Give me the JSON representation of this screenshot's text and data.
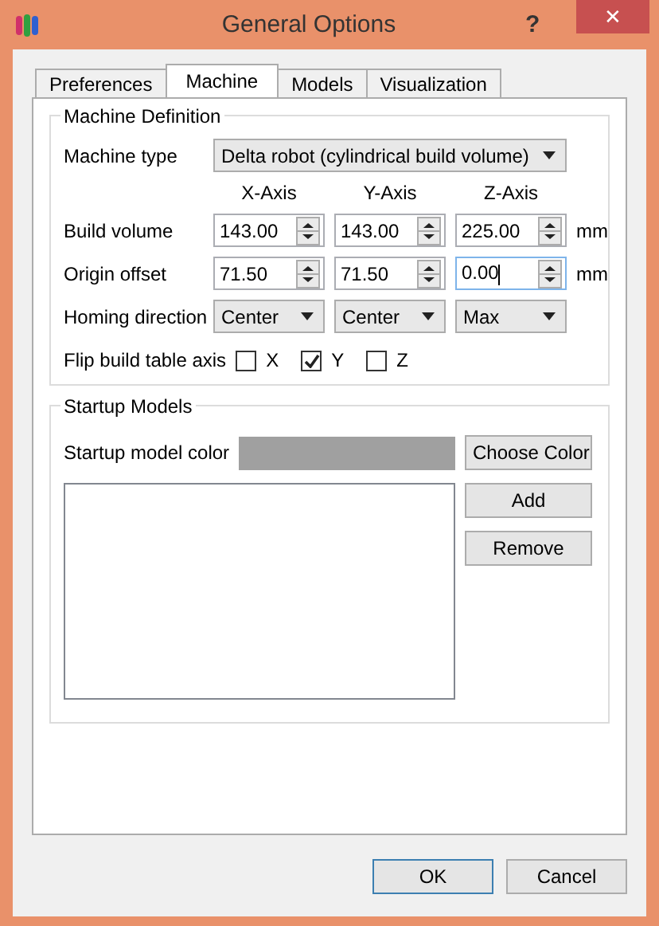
{
  "window": {
    "title": "General Options",
    "help": "?",
    "close": "✕"
  },
  "tabs": [
    {
      "label": "Preferences",
      "selected": false
    },
    {
      "label": "Machine",
      "selected": true
    },
    {
      "label": "Models",
      "selected": false
    },
    {
      "label": "Visualization",
      "selected": false
    }
  ],
  "machine_definition": {
    "title": "Machine Definition",
    "machine_type_label": "Machine type",
    "machine_type": "Delta robot (cylindrical build volume)",
    "axis_headers": [
      "X-Axis",
      "Y-Axis",
      "Z-Axis"
    ],
    "rows": [
      {
        "label": "Build volume",
        "kind": "spin",
        "unit": "mm",
        "fields": [
          {
            "value": "143.00",
            "focused": false
          },
          {
            "value": "143.00",
            "focused": false
          },
          {
            "value": "225.00",
            "focused": false
          }
        ]
      },
      {
        "label": "Origin offset",
        "kind": "spin",
        "unit": "mm",
        "fields": [
          {
            "value": "71.50",
            "focused": false
          },
          {
            "value": "71.50",
            "focused": false
          },
          {
            "value": "0.00",
            "focused": true
          }
        ]
      },
      {
        "label": "Homing direction",
        "kind": "combo",
        "fields": [
          {
            "value": "Center"
          },
          {
            "value": "Center"
          },
          {
            "value": "Max"
          }
        ]
      }
    ],
    "flip_label": "Flip build table axis",
    "flip": [
      {
        "label": "X",
        "checked": false
      },
      {
        "label": "Y",
        "checked": true
      },
      {
        "label": "Z",
        "checked": false
      }
    ]
  },
  "startup_models": {
    "title": "Startup Models",
    "color_label": "Startup model color",
    "color": "#a0a0a0",
    "buttons": [
      "Choose Color",
      "Add",
      "Remove"
    ]
  },
  "buttons": [
    "OK",
    "Cancel"
  ]
}
